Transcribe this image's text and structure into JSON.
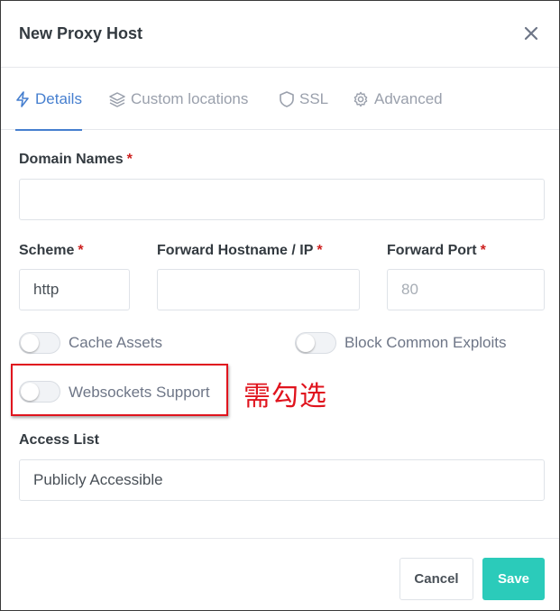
{
  "modal": {
    "title": "New Proxy Host",
    "close_icon": "close-icon"
  },
  "tabs": [
    {
      "label": "Details",
      "icon": "bolt-icon",
      "active": true
    },
    {
      "label": "Custom locations",
      "icon": "layers-icon",
      "active": false
    },
    {
      "label": "SSL",
      "icon": "shield-icon",
      "active": false
    },
    {
      "label": "Advanced",
      "icon": "gear-icon",
      "active": false
    }
  ],
  "form": {
    "domain_names": {
      "label": "Domain Names",
      "required_mark": "*",
      "value": ""
    },
    "scheme": {
      "label": "Scheme",
      "required_mark": "*",
      "value": "http"
    },
    "forward_hostname": {
      "label": "Forward Hostname / IP",
      "required_mark": "*",
      "value": ""
    },
    "forward_port": {
      "label": "Forward Port",
      "required_mark": "*",
      "placeholder": "80"
    },
    "toggles": {
      "cache_assets": {
        "label": "Cache Assets",
        "on": false
      },
      "block_exploits": {
        "label": "Block Common Exploits",
        "on": false
      },
      "websockets": {
        "label": "Websockets Support",
        "on": false
      }
    },
    "access_list": {
      "label": "Access List",
      "value": "Publicly Accessible"
    }
  },
  "annotation": {
    "text": "需勾选",
    "color": "#e0141e"
  },
  "footer": {
    "cancel_label": "Cancel",
    "save_label": "Save"
  },
  "colors": {
    "accent": "#467fcf",
    "save": "#2bcbba",
    "required": "#cd201f"
  }
}
